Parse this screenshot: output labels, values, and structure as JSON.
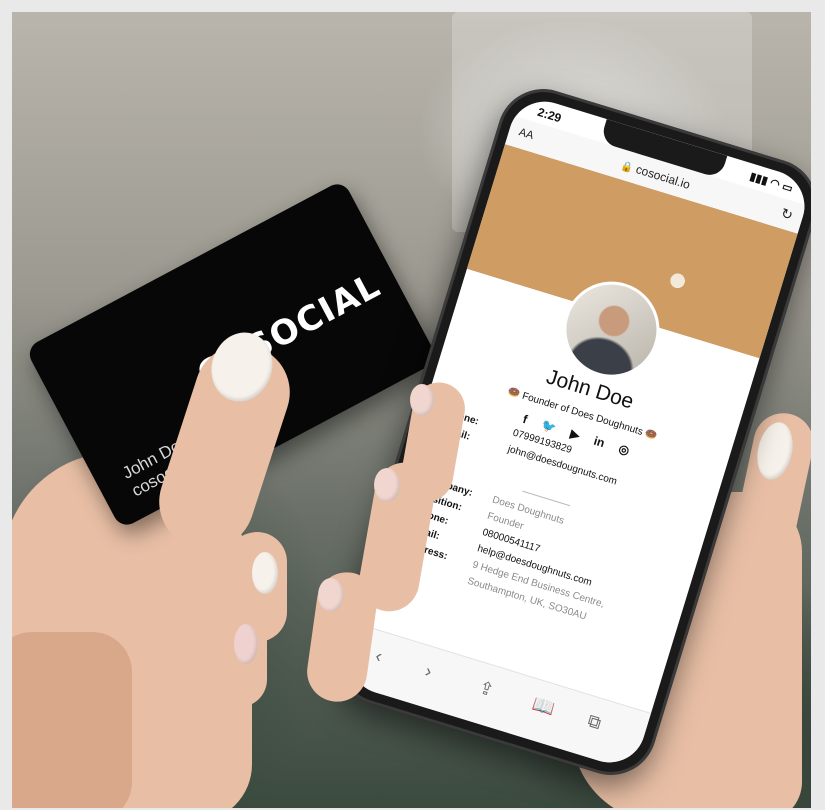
{
  "card": {
    "brand": "COSOCIAL",
    "name_line1": "John Doe",
    "name_line2": "cosocial"
  },
  "phone": {
    "status_time": "2:29",
    "url_aa": "AA",
    "url": "cosocial.io",
    "profile": {
      "name": "John Doe",
      "tagline": "🍩 Founder of Does Doughnuts 🍩",
      "contact": [
        {
          "label": "Phone:",
          "value": "07999193829"
        },
        {
          "label": "Email:",
          "value": "john@doesdougnuts.com"
        }
      ],
      "company": [
        {
          "label": "Company:",
          "value": "Does Doughnuts"
        },
        {
          "label": "Position:",
          "value": "Founder"
        },
        {
          "label": "Phone:",
          "value": "08000541117"
        },
        {
          "label": "Email:",
          "value": "help@doesdoughnuts.com"
        },
        {
          "label": "Address:",
          "value": "9 Hedge End Business Centre,"
        },
        {
          "label": "",
          "value": "Southampton, UK, SO30AU"
        }
      ]
    },
    "social_icons": [
      "facebook-icon",
      "twitter-icon",
      "youtube-icon",
      "linkedin-icon",
      "instagram-icon"
    ]
  },
  "colors": {
    "card": "#070707",
    "accent": "#111111"
  }
}
